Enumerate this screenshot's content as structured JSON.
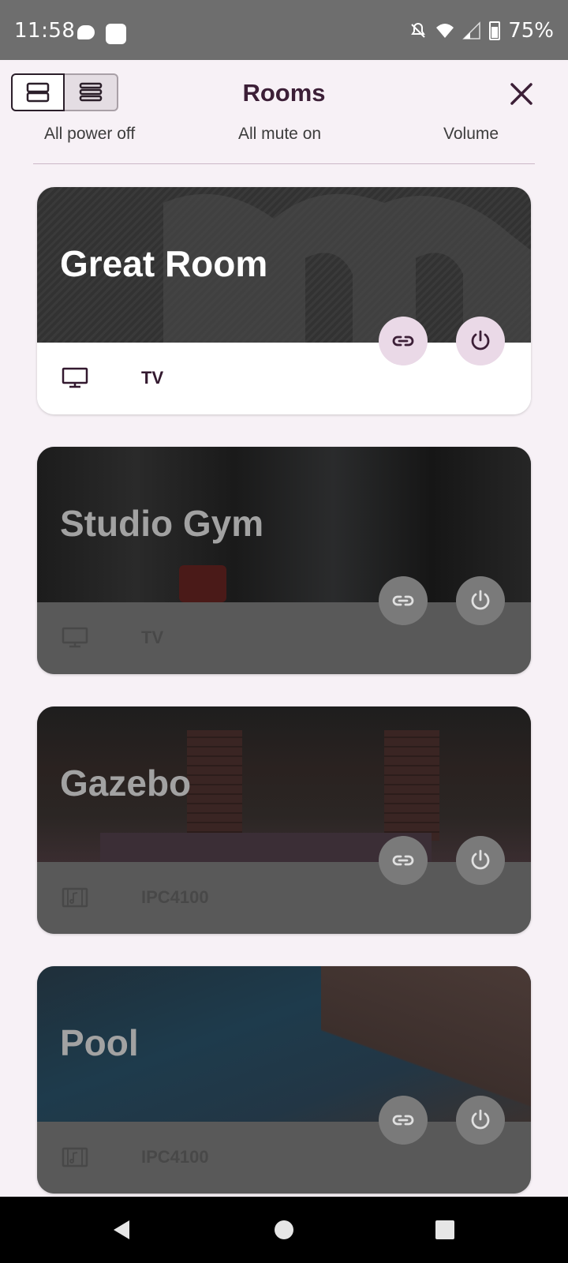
{
  "status_bar": {
    "time": "11:58",
    "battery": "75%",
    "icons": [
      "chat-bubble-icon",
      "app-notification-icon",
      "mute-icon",
      "wifi-icon",
      "cell-signal-icon",
      "battery-icon"
    ]
  },
  "header": {
    "title": "Rooms",
    "view_toggle": [
      "card-view-icon",
      "list-view-icon"
    ],
    "close_icon": "close-icon"
  },
  "actions": {
    "power_off": "All power off",
    "mute_on": "All mute on",
    "volume": "Volume"
  },
  "rooms": [
    {
      "name": "Great Room",
      "source": "TV",
      "source_icon": "monitor-icon",
      "state": "enabled"
    },
    {
      "name": "Studio Gym",
      "source": "TV",
      "source_icon": "monitor-icon",
      "state": "disabled"
    },
    {
      "name": "Gazebo",
      "source": "IPC4100",
      "source_icon": "film-music-icon",
      "state": "disabled"
    },
    {
      "name": "Pool",
      "source": "IPC4100",
      "source_icon": "film-music-icon",
      "state": "disabled"
    }
  ],
  "colors": {
    "accent": "#3c1f37",
    "button_enabled": "#ead9e7",
    "button_disabled": "#7a7a7a",
    "background": "#f7f1f6"
  }
}
